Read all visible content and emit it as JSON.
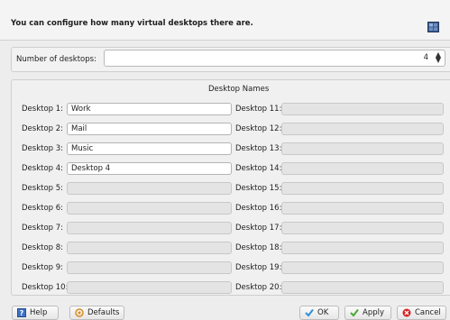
{
  "header": {
    "text": "You can configure how many virtual desktops there are.",
    "icon": "desktop-pager-icon"
  },
  "number_of_desktops": {
    "label": "Number of desktops:",
    "value": "4"
  },
  "desktop_names": {
    "title": "Desktop Names",
    "left": [
      {
        "label": "Desktop 1:",
        "value": "Work",
        "enabled": true
      },
      {
        "label": "Desktop 2:",
        "value": "Mail",
        "enabled": true
      },
      {
        "label": "Desktop 3:",
        "value": "Music",
        "enabled": true
      },
      {
        "label": "Desktop 4:",
        "value": "Desktop 4",
        "enabled": true
      },
      {
        "label": "Desktop 5:",
        "value": "",
        "enabled": false
      },
      {
        "label": "Desktop 6:",
        "value": "",
        "enabled": false
      },
      {
        "label": "Desktop 7:",
        "value": "",
        "enabled": false
      },
      {
        "label": "Desktop 8:",
        "value": "",
        "enabled": false
      },
      {
        "label": "Desktop 9:",
        "value": "",
        "enabled": false
      },
      {
        "label": "Desktop 10:",
        "value": "",
        "enabled": false
      }
    ],
    "right": [
      {
        "label": "Desktop 11:",
        "value": "",
        "enabled": false
      },
      {
        "label": "Desktop 12:",
        "value": "",
        "enabled": false
      },
      {
        "label": "Desktop 13:",
        "value": "",
        "enabled": false
      },
      {
        "label": "Desktop 14:",
        "value": "",
        "enabled": false
      },
      {
        "label": "Desktop 15:",
        "value": "",
        "enabled": false
      },
      {
        "label": "Desktop 16:",
        "value": "",
        "enabled": false
      },
      {
        "label": "Desktop 17:",
        "value": "",
        "enabled": false
      },
      {
        "label": "Desktop 18:",
        "value": "",
        "enabled": false
      },
      {
        "label": "Desktop 19:",
        "value": "",
        "enabled": false
      },
      {
        "label": "Desktop 20:",
        "value": "",
        "enabled": false
      }
    ]
  },
  "buttons": {
    "help": "Help",
    "defaults": "Defaults",
    "ok": "OK",
    "apply": "Apply",
    "cancel": "Cancel"
  },
  "colors": {
    "ok_check": "#2f8fd8",
    "apply_check": "#4aa832",
    "cancel_red": "#d42121"
  }
}
